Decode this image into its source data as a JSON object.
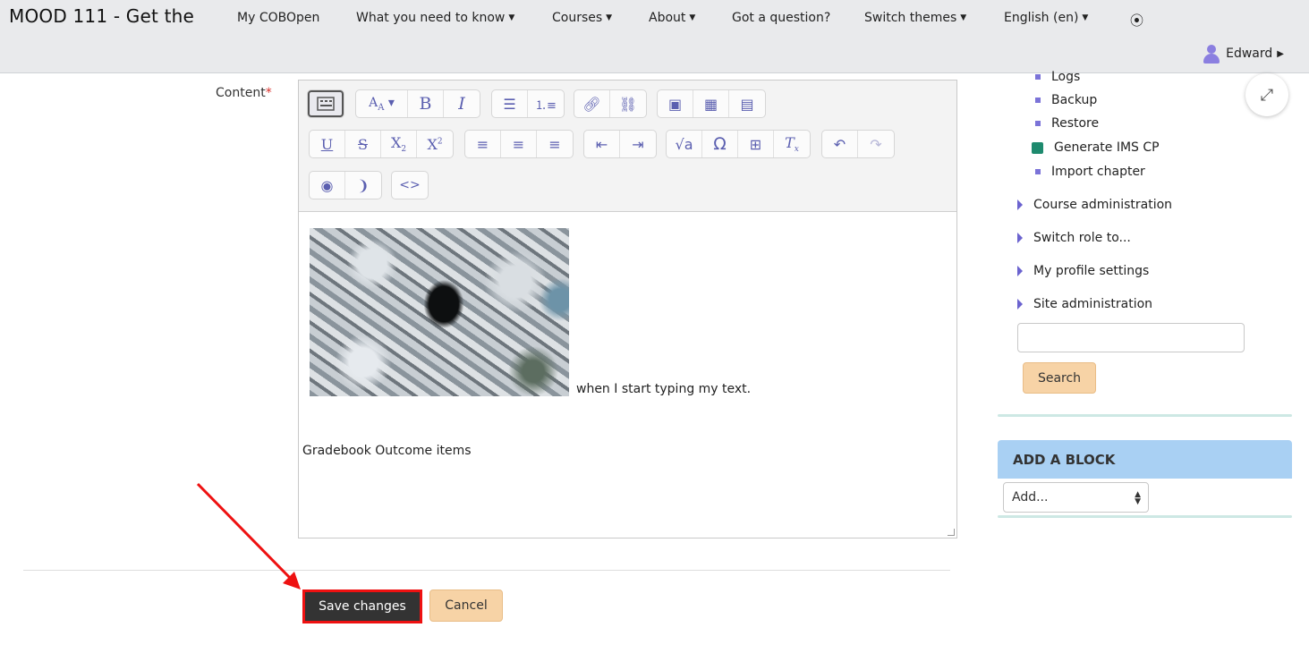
{
  "site": {
    "title": "MOOD 111 - Get the"
  },
  "nav": {
    "items": [
      {
        "label": "My COBOpen",
        "caret": false
      },
      {
        "label": "What you need to know",
        "caret": true
      },
      {
        "label": "Courses",
        "caret": true
      },
      {
        "label": "About",
        "caret": true
      },
      {
        "label": "Got a question?",
        "caret": false
      },
      {
        "label": "Switch themes",
        "caret": true
      },
      {
        "label": "English (en)",
        "caret": true
      }
    ],
    "extra_icon": "circle-dot-icon",
    "user_name": "Edward"
  },
  "form": {
    "content_label": "Content",
    "required_mark": "*",
    "body_text_after_image": "when I start typing my text.",
    "body_text_line2": "Gradebook Outcome items",
    "save_label": "Save changes",
    "cancel_label": "Cancel"
  },
  "toolbar": {
    "row1": [
      "toolbar-toggle",
      "font-style",
      "bold",
      "italic",
      "unordered-list",
      "ordered-list",
      "link",
      "unlink",
      "image",
      "media",
      "manage-files"
    ],
    "row2": [
      "underline",
      "strikethrough",
      "subscript",
      "superscript",
      "align-left",
      "align-center",
      "align-right",
      "outdent",
      "indent",
      "equation",
      "special-character",
      "table",
      "clear-formatting",
      "undo",
      "redo"
    ],
    "row3": [
      "accessibility-checker",
      "screen-reader-helper",
      "html-source"
    ]
  },
  "sidebar": {
    "admin_items": [
      {
        "label": "Logs",
        "icon": "bullet"
      },
      {
        "label": "Backup",
        "icon": "bullet"
      },
      {
        "label": "Restore",
        "icon": "bullet"
      },
      {
        "label": "Generate IMS CP",
        "icon": "cube-icon"
      },
      {
        "label": "Import chapter",
        "icon": "bullet"
      }
    ],
    "nodes": [
      {
        "label": "Course administration"
      },
      {
        "label": "Switch role to..."
      },
      {
        "label": "My profile settings"
      },
      {
        "label": "Site administration"
      }
    ],
    "search_button": "Search",
    "search_value": "",
    "add_block_title": "ADD A BLOCK",
    "add_select_value": "Add..."
  },
  "colors": {
    "accent": "#6b63cf",
    "save_bg": "#333333",
    "highlight": "#ee1111",
    "button_peach": "#f7d3a6",
    "block_header": "#a9d0f3"
  }
}
